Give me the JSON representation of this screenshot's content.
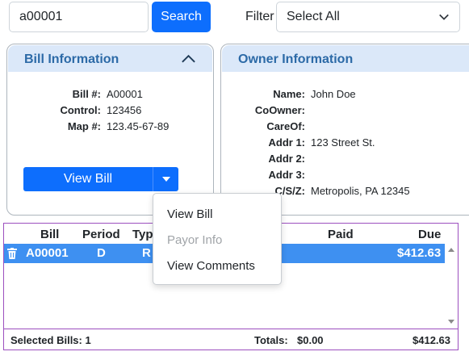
{
  "search": {
    "value": "a00001",
    "button_label": "Search"
  },
  "filter": {
    "label": "Filter",
    "selected": "Select All"
  },
  "bill_info": {
    "title": "Bill Information",
    "fields": [
      {
        "label": "Bill #:",
        "value": "A00001"
      },
      {
        "label": "Control:",
        "value": "123456"
      },
      {
        "label": "Map #:",
        "value": "123.45-67-89"
      }
    ],
    "view_bill_label": "View Bill"
  },
  "owner_info": {
    "title": "Owner Information",
    "fields": [
      {
        "label": "Name:",
        "value": "John Doe"
      },
      {
        "label": "CoOwner:",
        "value": ""
      },
      {
        "label": "CareOf:",
        "value": ""
      },
      {
        "label": "Addr 1:",
        "value": "123 Street St."
      },
      {
        "label": "Addr 2:",
        "value": ""
      },
      {
        "label": "Addr 3:",
        "value": ""
      },
      {
        "label": "C/S/Z:",
        "value": "Metropolis, PA 12345"
      }
    ]
  },
  "table": {
    "columns": [
      "Bill",
      "Period",
      "Typ",
      "Paid",
      "Due"
    ],
    "rows": [
      {
        "bill": "A00001",
        "period": "D",
        "type": "R",
        "paid": "",
        "due": "$412.63"
      }
    ]
  },
  "footer": {
    "selected_label": "Selected Bills: 1",
    "totals_label": "Totals:",
    "totals_paid": "$0.00",
    "totals_due": "$412.63"
  },
  "menu": {
    "items": [
      {
        "label": "View Bill",
        "enabled": true
      },
      {
        "label": "Payor Info",
        "enabled": false
      },
      {
        "label": "View Comments",
        "enabled": true
      }
    ]
  },
  "colors": {
    "primary": "#0d6efd",
    "panel_header": "#dbe8f9",
    "panel_title": "#2c6aa7",
    "selected_row": "#3e90f1",
    "grid_border": "#9c4fbf"
  },
  "icons": {
    "filter_chevron": "chevron-down-icon",
    "collapse": "chevron-up-icon",
    "split_toggle": "caret-down-icon",
    "delete": "trash-icon"
  }
}
